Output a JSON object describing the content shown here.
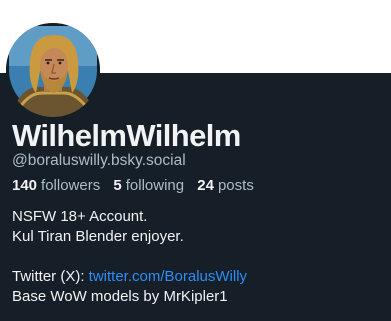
{
  "profile": {
    "display_name": "WilhelmWilhelm",
    "handle": "@boraluswilly.bsky.social",
    "avatar": "avatar-icon"
  },
  "stats": {
    "followers_count": "140",
    "followers_label": "followers",
    "following_count": "5",
    "following_label": "following",
    "posts_count": "24",
    "posts_label": "posts"
  },
  "bio": {
    "line1": "NSFW 18+ Account.",
    "line2": "Kul Tiran Blender enjoyer.",
    "twitter_label": "Twitter (X): ",
    "twitter_link": "twitter.com/BoralusWilly",
    "line5": "Base WoW models by MrKipler1"
  },
  "colors": {
    "background": "#161e27",
    "text": "#f1f3f5",
    "muted": "#aebbc9",
    "link": "#2c8ef9"
  }
}
